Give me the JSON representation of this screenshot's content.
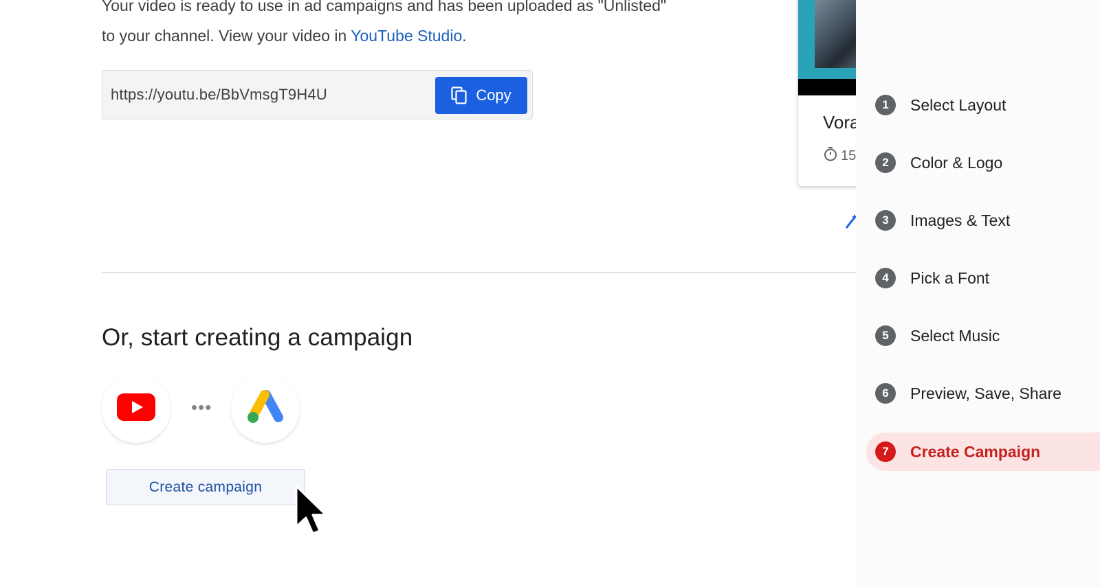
{
  "intro": {
    "line1": "Your video is ready to use in ad campaigns and has been uploaded as \"Unlisted\"",
    "line2_prefix": "to your channel. View your video in ",
    "link": "YouTube Studio",
    "line2_suffix": "."
  },
  "share": {
    "url": "https://youtu.be/BbVmsgT9H4U",
    "copy_label": "Copy"
  },
  "preview": {
    "title": "Vora",
    "duration": "15"
  },
  "campaign": {
    "title": "Or, start creating a campaign",
    "dots": "•••",
    "button_label": "Create campaign"
  },
  "steps": [
    {
      "num": "1",
      "label": "Select Layout"
    },
    {
      "num": "2",
      "label": "Color & Logo"
    },
    {
      "num": "3",
      "label": "Images & Text"
    },
    {
      "num": "4",
      "label": "Pick a Font"
    },
    {
      "num": "5",
      "label": "Select Music"
    },
    {
      "num": "6",
      "label": "Preview, Save, Share"
    },
    {
      "num": "7",
      "label": "Create Campaign"
    }
  ],
  "active_step": 7,
  "colors": {
    "primary_blue": "#1a60e0",
    "link_blue": "#1a5fbf",
    "active_red": "#d61a1a",
    "active_bg": "#fce4e4"
  },
  "icons": [
    "copy-icon",
    "stopwatch-icon",
    "magic-wand-icon",
    "youtube-logo",
    "google-ads-logo",
    "mouse-pointer"
  ]
}
